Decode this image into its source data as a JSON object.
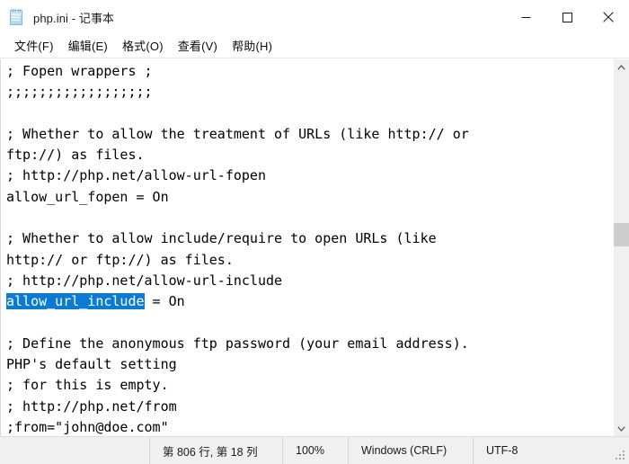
{
  "window": {
    "title": "php.ini - 记事本",
    "icon": "notepad-icon",
    "controls": {
      "minimize": "最小化",
      "maximize": "最大化",
      "close": "关闭"
    }
  },
  "menubar": {
    "items": [
      {
        "label": "文件(F)",
        "name": "menu-file"
      },
      {
        "label": "编辑(E)",
        "name": "menu-edit"
      },
      {
        "label": "格式(O)",
        "name": "menu-format"
      },
      {
        "label": "查看(V)",
        "name": "menu-view"
      },
      {
        "label": "帮助(H)",
        "name": "menu-help"
      }
    ]
  },
  "editor": {
    "selection": {
      "text": "allow_url_include",
      "highlight_color": "#0a7bd4",
      "text_color": "#ffffff"
    },
    "lines": [
      "; Fopen wrappers ;",
      ";;;;;;;;;;;;;;;;;;",
      "",
      "; Whether to allow the treatment of URLs (like http:// or",
      "ftp://) as files.",
      "; http://php.net/allow-url-fopen",
      "allow_url_fopen = On",
      "",
      "; Whether to allow include/require to open URLs (like",
      "http:// or ftp://) as files.",
      "; http://php.net/allow-url-include",
      "allow_url_include = On",
      "",
      "; Define the anonymous ftp password (your email address).",
      "PHP's default setting",
      "; for this is empty.",
      "; http://php.net/from",
      ";from=\"john@doe.com\""
    ],
    "selected_line_index": 11,
    "selected_line_prefix": "allow_url_include",
    "selected_line_suffix": " = On"
  },
  "scrollbar": {
    "up_arrow": "scroll-up",
    "down_arrow": "scroll-down",
    "thumb_position_percent": 46
  },
  "statusbar": {
    "position": "第 806 行, 第 18 列",
    "zoom": "100%",
    "line_ending": "Windows (CRLF)",
    "encoding": "UTF-8"
  }
}
